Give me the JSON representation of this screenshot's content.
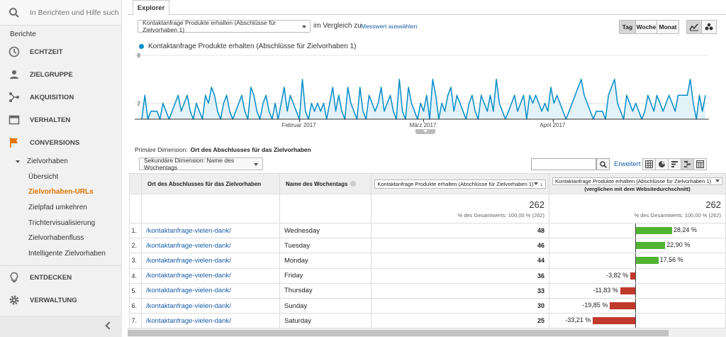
{
  "sidebar": {
    "search_placeholder": "In Berichten und Hilfe such",
    "section_label": "Berichte",
    "items": [
      {
        "label": "ECHTZEIT",
        "icon": "clock-icon"
      },
      {
        "label": "ZIELGRUPPE",
        "icon": "person-icon"
      },
      {
        "label": "AKQUISITION",
        "icon": "acquisition-icon"
      },
      {
        "label": "VERHALTEN",
        "icon": "window-icon"
      },
      {
        "label": "CONVERSIONS",
        "icon": "flag-icon",
        "color": "#e37400"
      }
    ],
    "sub_parent": "Zielvorhaben",
    "sub_items": [
      "Übersicht",
      "Zielvorhaben-URLs",
      "Zielpfad umkehren",
      "Trichtervisualisierung",
      "Zielvorhabenfluss",
      "Intelligente Zielvorhaben"
    ],
    "selected_sub": "Zielvorhaben-URLs",
    "bottom_items": [
      {
        "label": "ENTDECKEN",
        "icon": "lightbulb-icon"
      },
      {
        "label": "VERWALTUNG",
        "icon": "gear-icon"
      }
    ]
  },
  "explorer": {
    "tab": "Explorer",
    "metric": "Kontaktanfrage Produkte erhalten (Abschlüsse für Zielvorhaben 1)",
    "compare_text": "im Vergleich zu",
    "select_metric": "Messwert auswählen",
    "periods": [
      "Tag",
      "Woche",
      "Monat"
    ],
    "active_period": "Tag"
  },
  "chart_data": {
    "type": "area",
    "series": [
      {
        "name": "Kontaktanfrage Produkte erhalten (Abschlüsse für Zielvorhaben 1)",
        "color": "#058dc7"
      }
    ],
    "values": [
      0,
      3,
      0,
      1,
      1,
      1,
      0,
      2,
      1,
      0,
      1,
      2,
      3,
      1,
      2,
      3,
      1,
      0,
      2,
      1,
      0,
      3,
      2,
      4,
      3,
      1,
      0,
      2,
      3,
      1,
      0,
      1,
      2,
      3,
      1,
      0,
      4,
      3,
      1,
      0,
      2,
      3,
      1,
      0,
      2,
      0,
      2,
      4,
      1,
      3,
      2,
      1,
      0,
      5,
      1,
      0,
      2,
      1,
      2,
      1,
      2,
      0,
      2,
      4,
      1,
      3,
      1,
      0,
      4,
      2,
      1,
      0,
      4,
      1,
      0,
      3,
      2,
      1,
      2,
      4,
      1,
      2,
      3,
      1,
      0,
      5,
      1,
      0,
      4,
      2,
      1,
      0,
      2,
      1,
      3,
      0,
      5,
      3,
      0,
      2,
      1,
      3,
      4,
      1,
      3,
      2,
      1,
      0,
      2,
      3,
      1,
      0,
      3,
      2,
      1,
      3,
      1,
      5,
      2,
      1,
      0,
      1,
      2,
      3,
      1,
      2,
      3,
      0,
      3,
      2,
      3,
      2,
      1,
      2,
      1,
      4,
      2,
      3,
      2,
      1,
      0,
      1,
      2,
      3,
      4,
      5,
      3,
      2,
      1,
      0,
      1,
      1,
      1,
      0,
      3,
      4,
      5,
      2,
      1,
      0,
      3,
      2,
      1,
      2,
      1,
      0,
      1,
      3,
      2,
      1,
      3,
      2,
      1,
      2,
      3,
      2,
      1,
      3,
      3,
      3,
      3,
      5,
      2,
      0,
      3,
      1,
      3
    ],
    "ytick_labels": [
      "8",
      "2"
    ],
    "ylim": [
      0,
      8
    ],
    "x_tick_labels": [
      "Februar 2017",
      "März 2017",
      "April 2017"
    ],
    "grid": true
  },
  "table": {
    "primary_label": "Primäre Dimension:",
    "primary_value": "Ort des Abschlusses für das Zielvorhaben",
    "secondary": "Sekundäre Dimension: Name des Wochentags",
    "advanced": "Erweitert",
    "headers": {
      "col1": "Ort des Abschlusses für das Zielvorhaben",
      "col2": "Name des Wochentags",
      "col3": "Kontaktanfrage Produkte erhalten (Abschlüsse für Zielvorhaben 1)",
      "col4": "Kontaktanfrage Produkte erhalten (Abschlüsse für Zielvorhaben 1)",
      "col4_sub": "(verglichen mit dem Websitedurchschnitt)"
    },
    "total_value": "262",
    "total_sub": "% des Gesamtwerts: 100,00 % (262)",
    "compare_total_value": "262",
    "compare_total_sub": "% des Gesamtwerts: 100,00 % (262)",
    "rows": [
      {
        "idx": "1.",
        "loc": "/kontaktanfrage-vielen-dank/",
        "day": "Wednesday",
        "value": "48",
        "pct": "28,24 %",
        "delta": 28.24
      },
      {
        "idx": "2.",
        "loc": "/kontaktanfrage-vielen-dank/",
        "day": "Tuesday",
        "value": "46",
        "pct": "22,90 %",
        "delta": 22.9
      },
      {
        "idx": "3.",
        "loc": "/kontaktanfrage-vielen-dank/",
        "day": "Monday",
        "value": "44",
        "pct": "17,56 %",
        "delta": 17.56
      },
      {
        "idx": "4.",
        "loc": "/kontaktanfrage-vielen-dank/",
        "day": "Friday",
        "value": "36",
        "pct": "-3,82 %",
        "delta": -3.82
      },
      {
        "idx": "5.",
        "loc": "/kontaktanfrage-vielen-dank/",
        "day": "Thursday",
        "value": "33",
        "pct": "-11,83 %",
        "delta": -11.83
      },
      {
        "idx": "6.",
        "loc": "/kontaktanfrage-vielen-dank/",
        "day": "Sunday",
        "value": "30",
        "pct": "-19,85 %",
        "delta": -19.85
      },
      {
        "idx": "7.",
        "loc": "/kontaktanfrage-vielen-dank/",
        "day": "Saturday",
        "value": "25",
        "pct": "-33,21 %",
        "delta": -33.21
      }
    ]
  },
  "colors": {
    "positive": "#50b432",
    "negative": "#c0392b",
    "link": "#1a5da6",
    "accent": "#e37400",
    "series": "#058dc7"
  }
}
